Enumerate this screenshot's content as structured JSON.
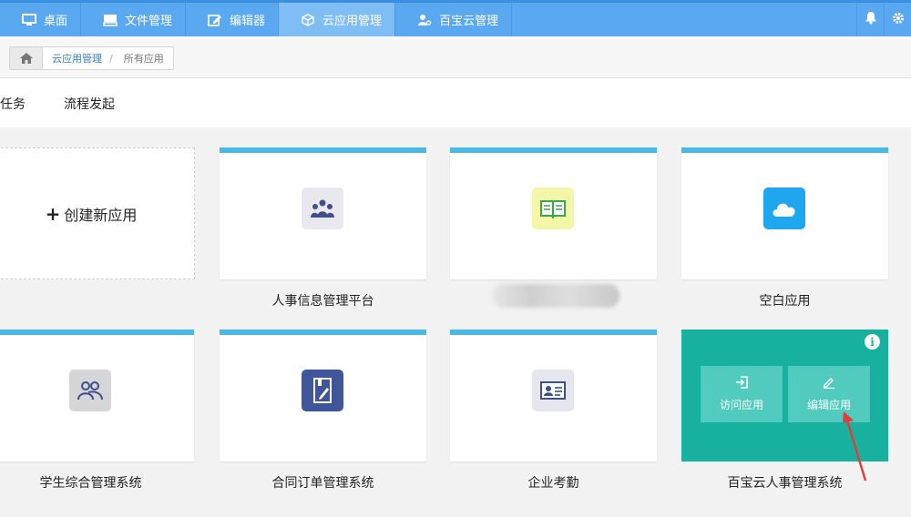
{
  "nav": {
    "items": [
      {
        "label": "桌面",
        "icon": "desktop-icon"
      },
      {
        "label": "文件管理",
        "icon": "file-manage-icon"
      },
      {
        "label": "编辑器",
        "icon": "edit-icon"
      },
      {
        "label": "云应用管理",
        "icon": "cube-icon"
      },
      {
        "label": "百宝云管理",
        "icon": "user-gear-icon"
      }
    ],
    "active_index": 3
  },
  "breadcrumb": {
    "parent": "云应用管理",
    "separator": "/",
    "current": "所有应用"
  },
  "tabs": [
    "办任务",
    "流程发起"
  ],
  "new_app": {
    "plus": "+",
    "label": "创建新应用"
  },
  "apps": [
    {
      "label": "人事信息管理平台",
      "icon": "people-group-icon"
    },
    {
      "label": "",
      "icon": "book-icon"
    },
    {
      "label": "空白应用",
      "icon": "cloud-icon"
    },
    {
      "label": "学生综合管理系统",
      "icon": "users-icon"
    },
    {
      "label": "合同订单管理系统",
      "icon": "notebook-pen-icon"
    },
    {
      "label": "企业考勤",
      "icon": "id-card-icon"
    },
    {
      "label": "百宝云人事管理系统",
      "icon": "app-icon"
    }
  ],
  "hover_actions": {
    "visit": "访问应用",
    "edit": "编辑应用",
    "info": "i"
  },
  "colors": {
    "nav": "#5aa8f0",
    "card_top": "#4bb8e6",
    "hover": "#18b1a0"
  }
}
